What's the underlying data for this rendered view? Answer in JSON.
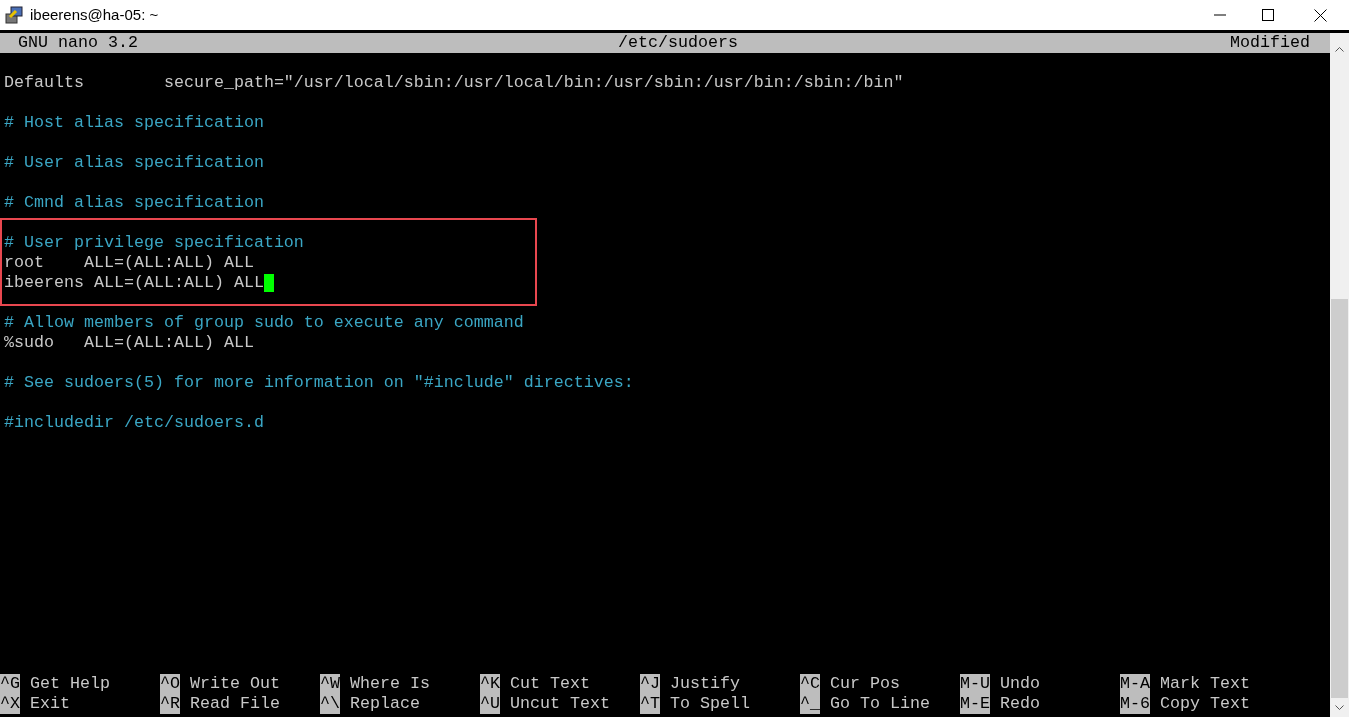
{
  "window": {
    "title": "ibeerens@ha-05: ~"
  },
  "header": {
    "app": "GNU nano 3.2",
    "file": "/etc/sudoers",
    "status": "Modified"
  },
  "blocks": [
    [
      {
        "kind": "setting",
        "text": "Defaults        secure_path=\"/usr/local/sbin:/usr/local/bin:/usr/sbin:/usr/bin:/sbin:/bin\""
      }
    ],
    [
      {
        "kind": "comment",
        "text": "# Host alias specification"
      }
    ],
    [
      {
        "kind": "comment",
        "text": "# User alias specification"
      }
    ],
    [
      {
        "kind": "comment",
        "text": "# Cmnd alias specification"
      }
    ],
    [
      {
        "kind": "comment",
        "text": "# User privilege specification"
      },
      {
        "kind": "setting",
        "text": "root    ALL=(ALL:ALL) ALL"
      },
      {
        "kind": "setting",
        "text": "ibeerens ALL=(ALL:ALL) ALL",
        "cursor": true
      }
    ],
    [
      {
        "kind": "comment",
        "text": "# Allow members of group sudo to execute any command"
      },
      {
        "kind": "setting",
        "text": "%sudo   ALL=(ALL:ALL) ALL"
      }
    ],
    [
      {
        "kind": "comment",
        "text": "# See sudoers(5) for more information on \"#include\" directives:"
      }
    ],
    [
      {
        "kind": "comment",
        "text": "#includedir /etc/sudoers.d"
      }
    ]
  ],
  "shortcuts": [
    [
      {
        "key": "^G",
        "label": "Get Help"
      },
      {
        "key": "^O",
        "label": "Write Out"
      },
      {
        "key": "^W",
        "label": "Where Is"
      },
      {
        "key": "^K",
        "label": "Cut Text"
      },
      {
        "key": "^J",
        "label": "Justify"
      },
      {
        "key": "^C",
        "label": "Cur Pos"
      },
      {
        "key": "M-U",
        "label": "Undo"
      },
      {
        "key": "M-A",
        "label": "Mark Text"
      }
    ],
    [
      {
        "key": "^X",
        "label": "Exit"
      },
      {
        "key": "^R",
        "label": "Read File"
      },
      {
        "key": "^\\",
        "label": "Replace"
      },
      {
        "key": "^U",
        "label": "Uncut Text"
      },
      {
        "key": "^T",
        "label": "To Spell"
      },
      {
        "key": "^_",
        "label": "Go To Line"
      },
      {
        "key": "M-E",
        "label": "Redo"
      },
      {
        "key": "M-6",
        "label": "Copy Text"
      }
    ]
  ]
}
